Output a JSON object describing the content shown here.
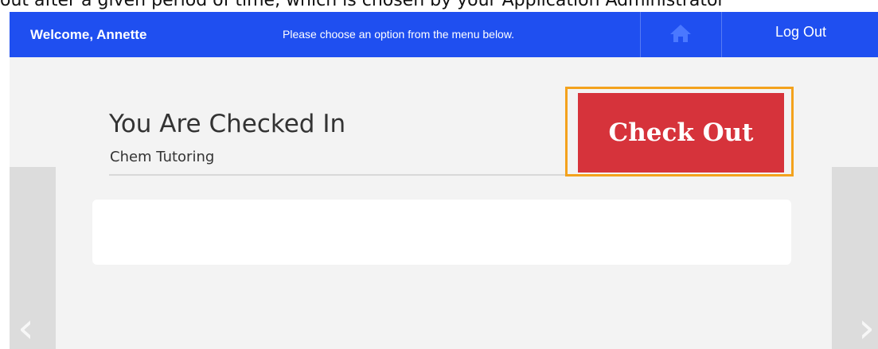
{
  "caption": "out after a given period of time, which is chosen by your Application Administrator",
  "header": {
    "welcome": "Welcome, Annette",
    "instructions": "Please choose an option from the menu below.",
    "home_icon": "home-icon",
    "logout_label": "Log Out",
    "background_color": "#1f4ff0"
  },
  "status": {
    "title": "You Are Checked In",
    "activity": "Chem Tutoring"
  },
  "actions": {
    "checkout_label": "Check Out",
    "checkout_color": "#d6333b",
    "highlight_color": "#f3a21d"
  },
  "navigation": {
    "prev_icon": "chevron-left-icon",
    "next_icon": "chevron-right-icon"
  }
}
